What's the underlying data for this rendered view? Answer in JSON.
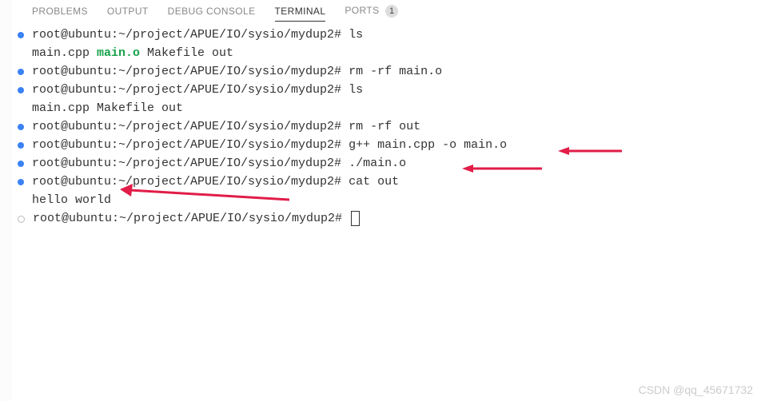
{
  "tabs": {
    "problems": "PROBLEMS",
    "output": "OUTPUT",
    "debug": "DEBUG CONSOLE",
    "terminal": "TERMINAL",
    "ports": "PORTS",
    "ports_badge": "1"
  },
  "prompt": "root@ubuntu:~/project/APUE/IO/sysio/mydup2#",
  "lines": [
    {
      "bullet": "solid",
      "prompt": true,
      "cmd": "ls"
    },
    {
      "bullet": null,
      "prompt": false,
      "output_parts": [
        {
          "t": "main.cpp  ",
          "cls": ""
        },
        {
          "t": "main.o",
          "cls": "file-green"
        },
        {
          "t": "  Makefile  out",
          "cls": ""
        }
      ]
    },
    {
      "bullet": "solid",
      "prompt": true,
      "cmd": "rm -rf main.o"
    },
    {
      "bullet": "solid",
      "prompt": true,
      "cmd": "ls"
    },
    {
      "bullet": null,
      "prompt": false,
      "output": "main.cpp  Makefile  out"
    },
    {
      "bullet": "solid",
      "prompt": true,
      "cmd": "rm -rf out"
    },
    {
      "bullet": "solid",
      "prompt": true,
      "cmd": "g++ main.cpp -o main.o"
    },
    {
      "bullet": "solid",
      "prompt": true,
      "cmd": "./main.o"
    },
    {
      "bullet": "solid",
      "prompt": true,
      "cmd": "cat out"
    },
    {
      "bullet": null,
      "prompt": false,
      "output": "hello world"
    },
    {
      "bullet": "hollow",
      "prompt": true,
      "cmd": "",
      "cursor": true
    }
  ],
  "watermark": "CSDN @qq_45671732"
}
